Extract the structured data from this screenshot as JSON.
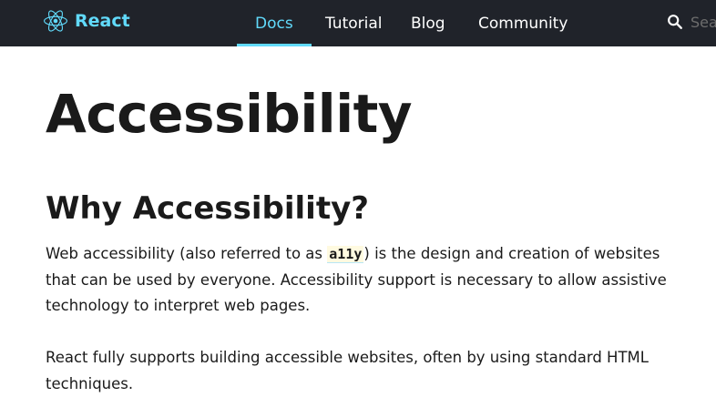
{
  "nav": {
    "logo_text": "React",
    "links": [
      "Docs",
      "Tutorial",
      "Blog",
      "Community"
    ],
    "active": "Docs",
    "search_placeholder": "Search"
  },
  "article": {
    "title": "Accessibility",
    "section_heading": "Why Accessibility?",
    "p1_before": "Web accessibility (also referred to as ",
    "p1_code": "a11y",
    "p1_after": ") is the design and creation of websites that can be used by everyone. Accessibility support is necessary to allow assistive technology to interpret web pages.",
    "p2": "React fully supports building accessible websites, often by using standard HTML techniques."
  },
  "colors": {
    "navbar_bg": "#20232a",
    "brand": "#61dafb",
    "text": "#1a1a1a"
  }
}
